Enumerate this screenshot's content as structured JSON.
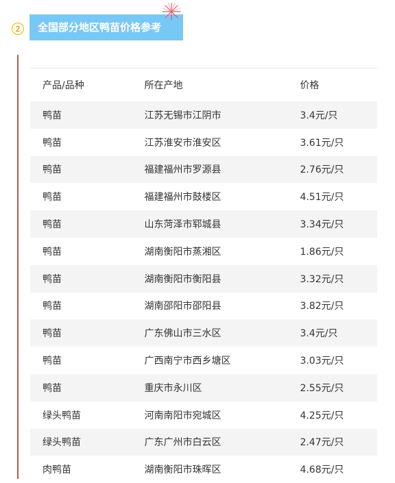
{
  "section": {
    "step_number": "2",
    "title": "全国部分地区鸭苗价格参考",
    "accent_color": "#78c8f5"
  },
  "table": {
    "headers": {
      "product": "产品/品种",
      "origin": "所在产地",
      "price": "价格"
    },
    "rows": [
      {
        "product": "鸭苗",
        "origin": "江苏无锡市江阴市",
        "price": "3.4元/只"
      },
      {
        "product": "鸭苗",
        "origin": "江苏淮安市淮安区",
        "price": "3.61元/只"
      },
      {
        "product": "鸭苗",
        "origin": "福建福州市罗源县",
        "price": "2.76元/只"
      },
      {
        "product": "鸭苗",
        "origin": "福建福州市鼓楼区",
        "price": "4.51元/只"
      },
      {
        "product": "鸭苗",
        "origin": "山东菏泽市郓城县",
        "price": "3.34元/只"
      },
      {
        "product": "鸭苗",
        "origin": "湖南衡阳市蒸湘区",
        "price": "1.86元/只"
      },
      {
        "product": "鸭苗",
        "origin": "湖南衡阳市衡阳县",
        "price": "3.32元/只"
      },
      {
        "product": "鸭苗",
        "origin": "湖南邵阳市邵阳县",
        "price": "3.82元/只"
      },
      {
        "product": "鸭苗",
        "origin": "广东佛山市三水区",
        "price": "3.4元/只"
      },
      {
        "product": "鸭苗",
        "origin": "广西南宁市西乡塘区",
        "price": "3.03元/只"
      },
      {
        "product": "鸭苗",
        "origin": "重庆市永川区",
        "price": "2.55元/只"
      },
      {
        "product": "绿头鸭苗",
        "origin": "河南南阳市宛城区",
        "price": "4.25元/只"
      },
      {
        "product": "绿头鸭苗",
        "origin": "广东广州市白云区",
        "price": "2.47元/只"
      },
      {
        "product": "肉鸭苗",
        "origin": "湖南衡阳市珠晖区",
        "price": "4.68元/只"
      }
    ]
  }
}
